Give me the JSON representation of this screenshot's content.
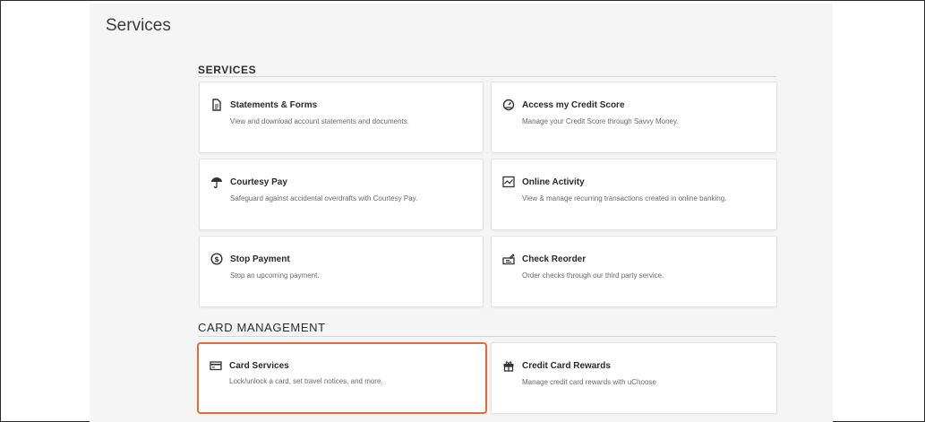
{
  "page": {
    "title": "Services"
  },
  "sections": [
    {
      "title": "SERVICES",
      "cards": [
        {
          "title": "Statements & Forms",
          "description": "View and download account statements and documents.",
          "icon": "document-icon"
        },
        {
          "title": "Access my Credit Score",
          "description": "Manage your Credit Score through Savvy Money.",
          "icon": "gauge-icon"
        },
        {
          "title": "Courtesy Pay",
          "description": "Safeguard against accidental overdrafts with Courtesy Pay.",
          "icon": "umbrella-icon"
        },
        {
          "title": "Online Activity",
          "description": "View & manage recurring transactions created in online banking.",
          "icon": "activity-chart-icon"
        },
        {
          "title": "Stop Payment",
          "description": "Stop an upcoming payment.",
          "icon": "dollar-circle-icon"
        },
        {
          "title": "Check Reorder",
          "description": "Order checks through our third party service.",
          "icon": "checkbook-icon"
        }
      ]
    },
    {
      "title": "CARD MANAGEMENT",
      "cards": [
        {
          "title": "Card Services",
          "description": "Lock/unlock a card, set travel notices, and more.",
          "icon": "credit-card-icon"
        },
        {
          "title": "Credit Card Rewards",
          "description": "Manage credit card rewards with uChoose",
          "icon": "gift-icon"
        }
      ]
    }
  ],
  "colors": {
    "selected_border": "#e36b3b",
    "panel_bg": "#f5f5f5",
    "card_bg": "#ffffff"
  }
}
